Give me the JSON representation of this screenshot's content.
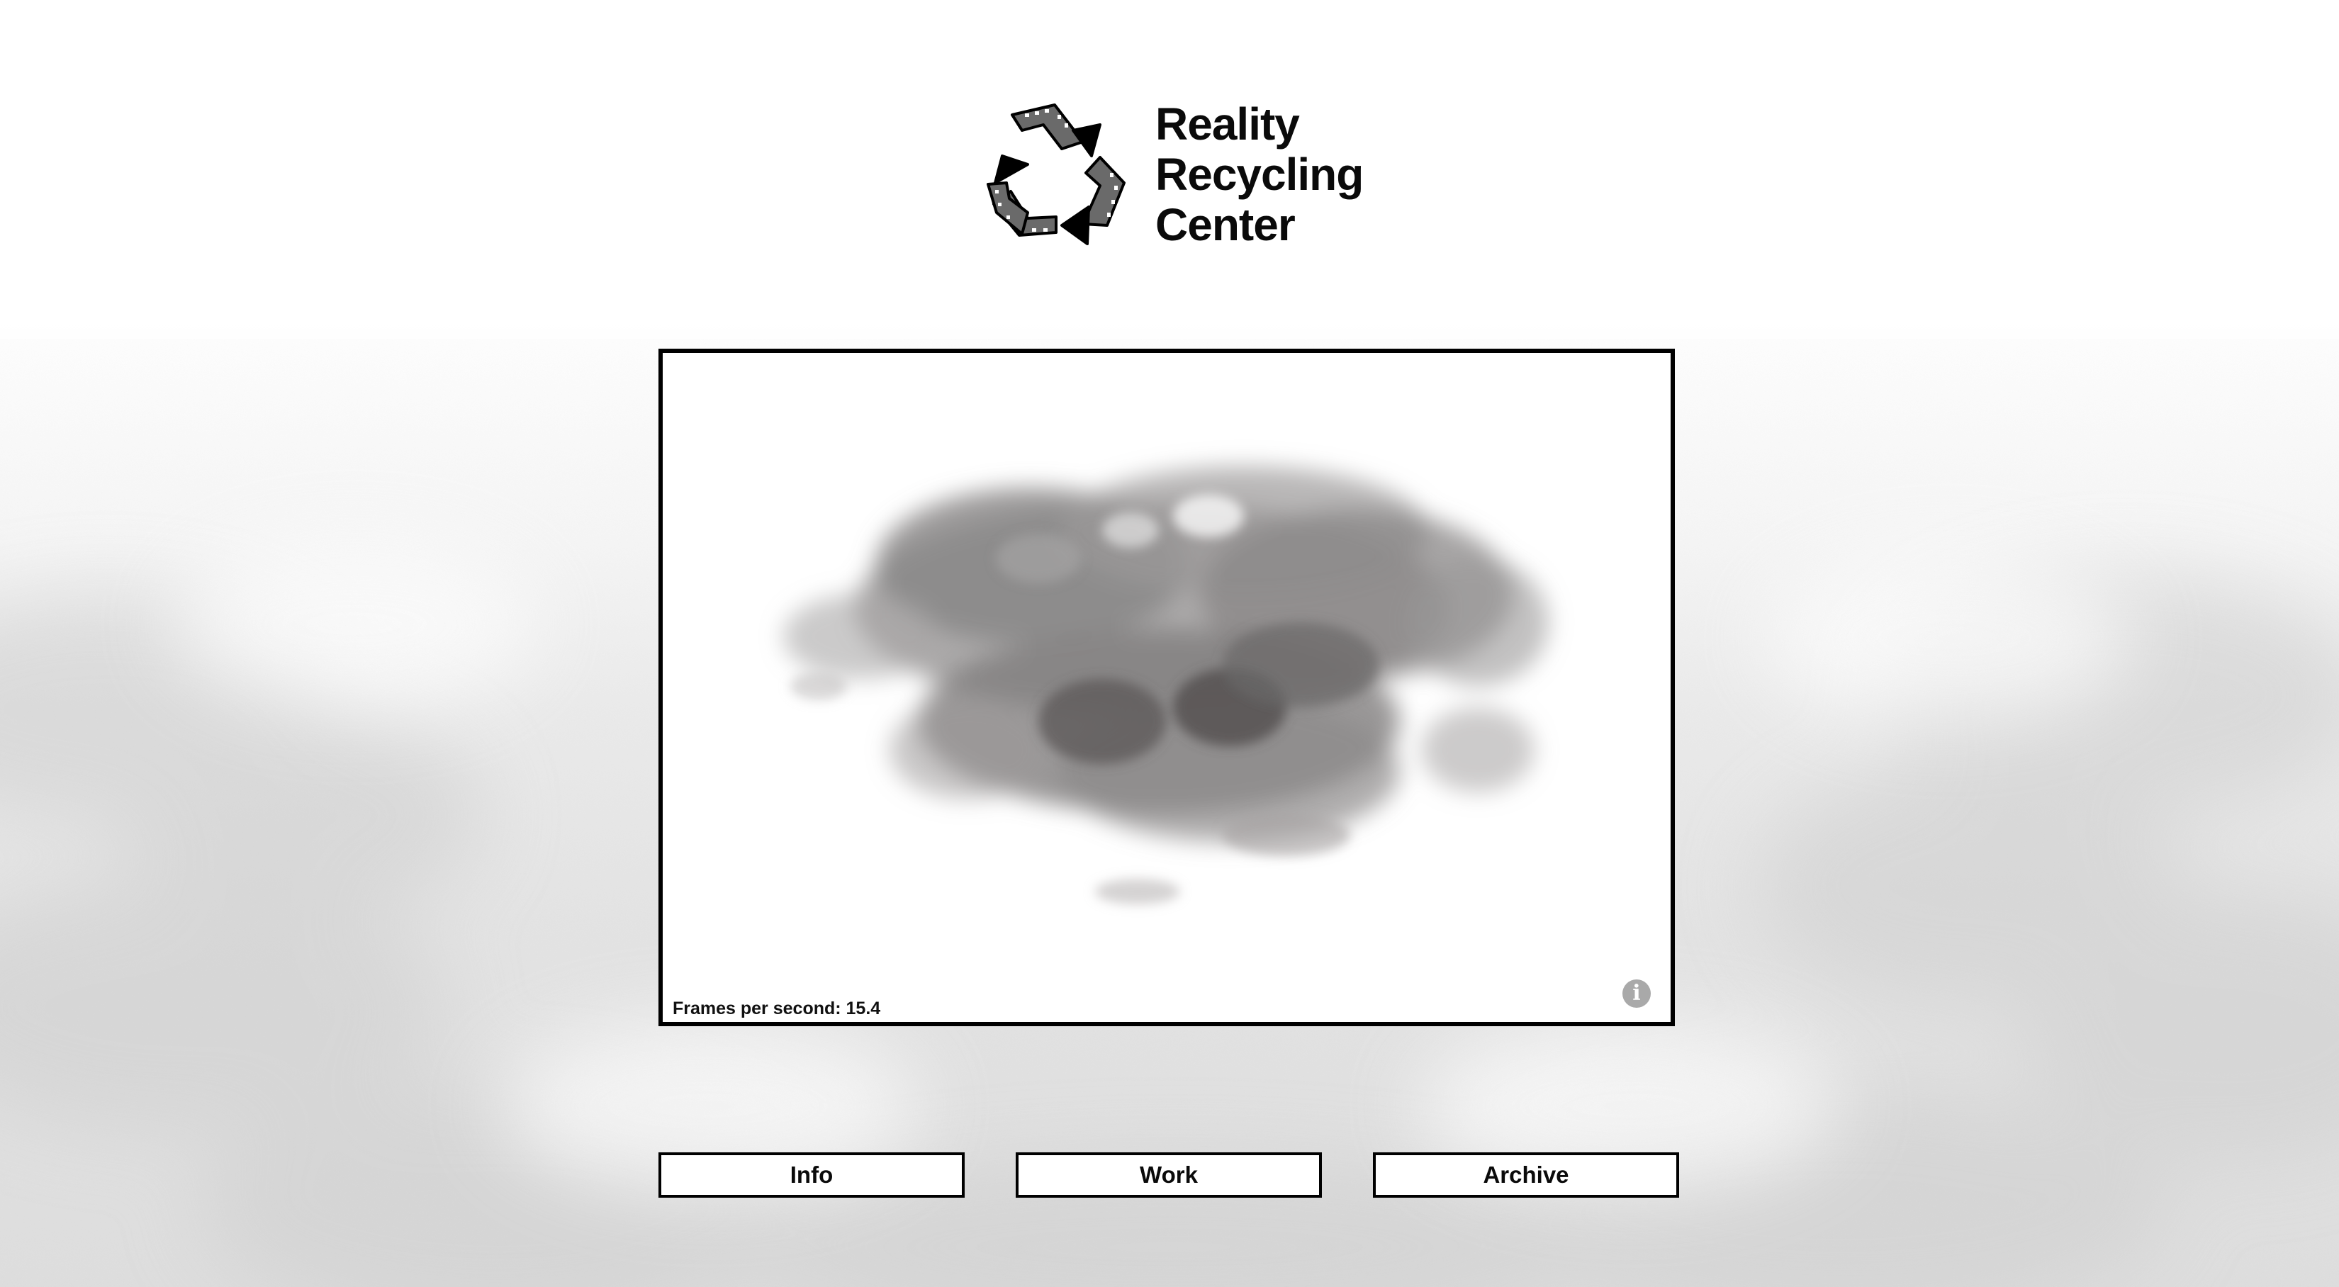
{
  "logo": {
    "lines": [
      "Reality",
      "Recycling",
      "Center"
    ],
    "symbol_icon": "film-recycle-icon"
  },
  "viewer": {
    "fps_label": "Frames per second:",
    "fps_value": "15.4",
    "info_icon": "info-icon",
    "info_glyph": "i"
  },
  "nav": {
    "info_label": "Info",
    "work_label": "Work",
    "archive_label": "Archive"
  },
  "colors": {
    "frame_border": "#000000",
    "text": "#0a0a0a",
    "info_icon_bg": "#a9a9a9",
    "cloud": "#6b6868"
  }
}
